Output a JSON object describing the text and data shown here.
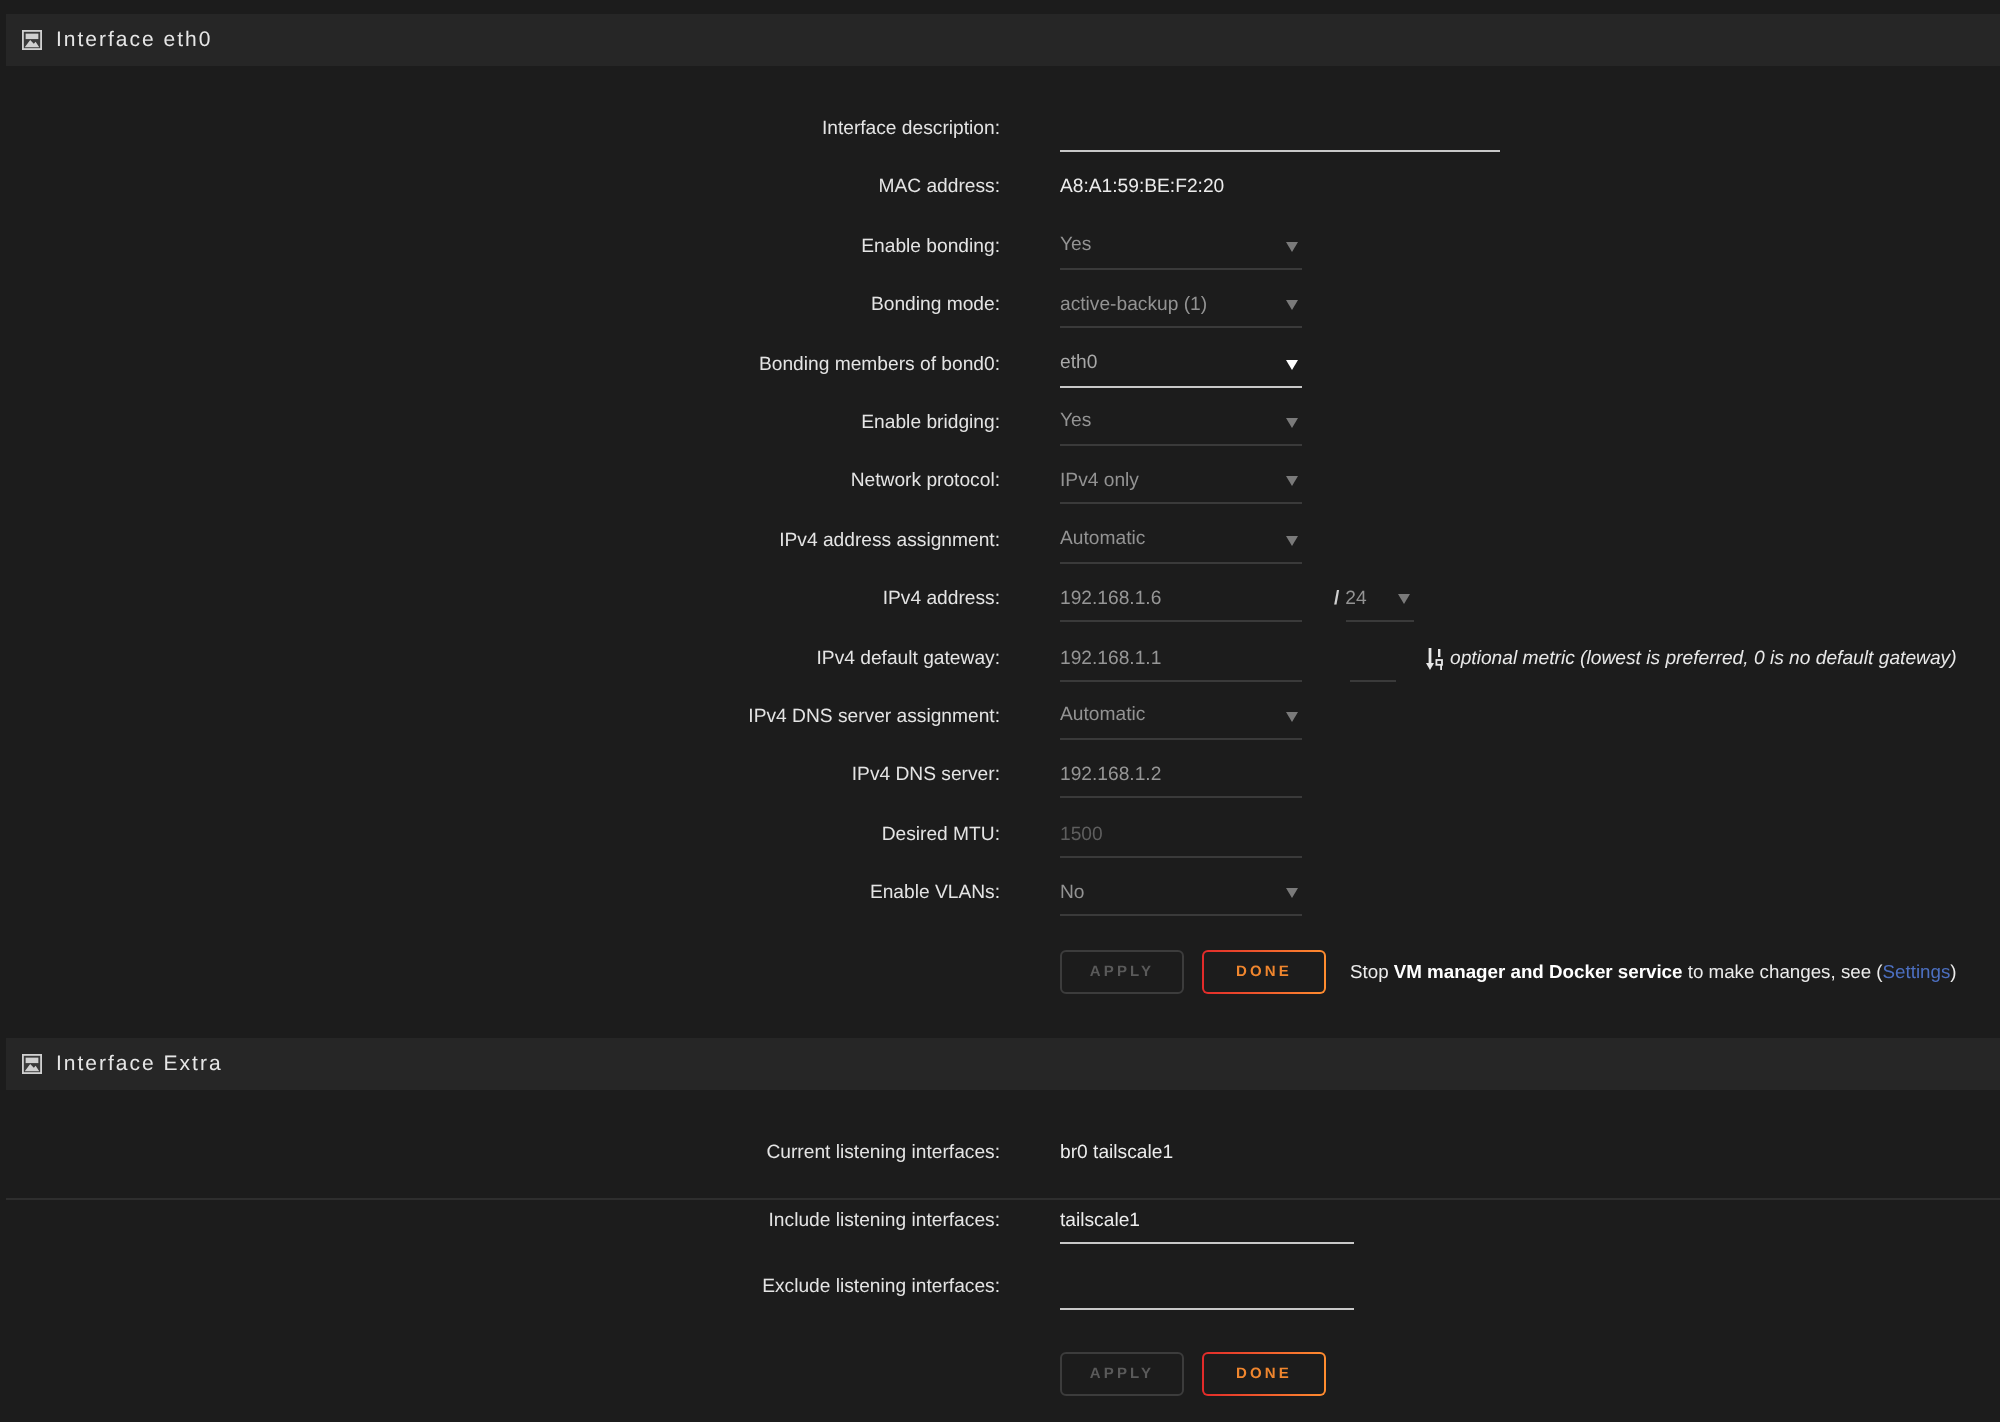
{
  "sections": [
    {
      "title": "Interface eth0",
      "rows": [
        {
          "kind": "input",
          "label": "Interface description:",
          "disabled": false
        },
        {
          "kind": "text",
          "label": "MAC address:",
          "value": "A8:A1:59:BE:F2:20"
        },
        {
          "kind": "select",
          "label": "Enable bonding:",
          "value": "Yes",
          "disabled": true
        },
        {
          "kind": "select",
          "label": "Bonding mode:",
          "value": "active-backup (1)",
          "disabled": true
        },
        {
          "kind": "select",
          "label": "Bonding members of bond0:",
          "value": "eth0",
          "disabled": false
        },
        {
          "kind": "select",
          "label": "Enable bridging:",
          "value": "Yes",
          "disabled": true
        },
        {
          "kind": "select",
          "label": "Network protocol:",
          "value": "IPv4 only",
          "disabled": true
        },
        {
          "kind": "select",
          "label": "IPv4 address assignment:",
          "value": "Automatic",
          "disabled": true
        },
        {
          "kind": "address",
          "label": "IPv4 address:",
          "value": "192.168.1.6",
          "disabled": true,
          "separator": "/",
          "prefix": {
            "value": "24",
            "disabled": true
          }
        },
        {
          "kind": "gateway",
          "label": "IPv4 default gateway:",
          "value": "192.168.1.1",
          "disabled": true,
          "metric": {
            "disabled": true
          },
          "note": "optional metric (lowest is preferred, 0 is no default gateway)"
        },
        {
          "kind": "select",
          "label": "IPv4 DNS server assignment:",
          "value": "Automatic",
          "disabled": true
        },
        {
          "kind": "input",
          "label": "IPv4 DNS server:",
          "value": "192.168.1.2",
          "disabled": true
        },
        {
          "kind": "input",
          "label": "Desired MTU:",
          "placeholder": "1500",
          "disabled": true
        },
        {
          "kind": "select",
          "label": "Enable VLANs:",
          "value": "No",
          "disabled": true
        }
      ],
      "buttons": [
        {
          "label": "APPLY",
          "disabled": true
        },
        {
          "label": "DONE",
          "disabled": false
        }
      ],
      "note": {
        "text": "Stop **VM manager and Docker service** to make changes, see (",
        "link": "Settings",
        "after": ")"
      }
    },
    {
      "title": "Interface Extra",
      "rows": [
        {
          "kind": "text",
          "label": "Current listening interfaces:",
          "value": "br0 tailscale1",
          "divider_after": true
        },
        {
          "kind": "input",
          "label": "Include listening interfaces:",
          "value": "tailscale1",
          "disabled": false
        },
        {
          "kind": "input",
          "label": "Exclude listening interfaces:",
          "disabled": false
        }
      ],
      "buttons": [
        {
          "label": "APPLY",
          "disabled": true
        },
        {
          "label": "DONE",
          "disabled": false
        }
      ]
    }
  ]
}
